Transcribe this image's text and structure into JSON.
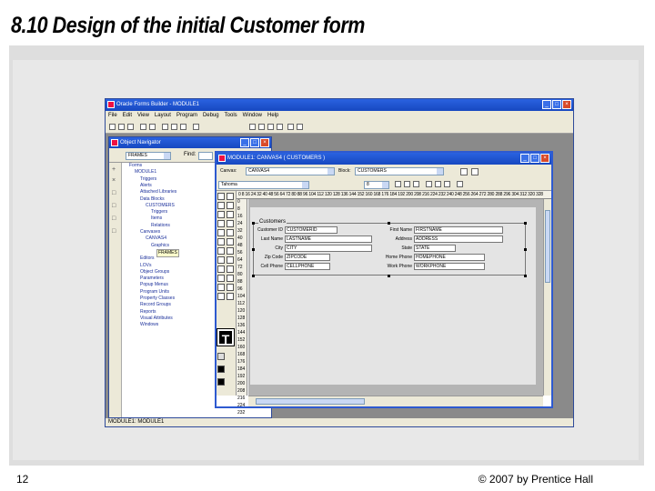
{
  "slide": {
    "title": "8.10 Design of the initial Customer form",
    "number": "12",
    "copyright": "© 2007 by Prentice Hall"
  },
  "app": {
    "title": "Oracle Forms Builder - MODULE1",
    "menu": [
      "File",
      "Edit",
      "View",
      "Layout",
      "Program",
      "Debug",
      "Tools",
      "Window",
      "Help"
    ],
    "status_text": "MODULE1: MODULE1"
  },
  "navigator": {
    "title": "Object Navigator",
    "search_value": "FRAMES",
    "find_label": "Find:",
    "tree": [
      {
        "label": "Forms",
        "level": 0
      },
      {
        "label": "MODULE1",
        "level": 1
      },
      {
        "label": "Triggers",
        "level": 2
      },
      {
        "label": "Alerts",
        "level": 2
      },
      {
        "label": "Attached Libraries",
        "level": 2
      },
      {
        "label": "Data Blocks",
        "level": 2
      },
      {
        "label": "CUSTOMERS",
        "level": 3
      },
      {
        "label": "Triggers",
        "level": 4
      },
      {
        "label": "Items",
        "level": 4
      },
      {
        "label": "Relations",
        "level": 4
      },
      {
        "label": "Canvases",
        "level": 2
      },
      {
        "label": "CANVAS4",
        "level": 3
      },
      {
        "label": "Graphics",
        "level": 4
      },
      {
        "label": "FRAMES",
        "level": 5,
        "selected": true
      },
      {
        "label": "Editors",
        "level": 2
      },
      {
        "label": "LOVs",
        "level": 2
      },
      {
        "label": "Object Groups",
        "level": 2
      },
      {
        "label": "Parameters",
        "level": 2
      },
      {
        "label": "Popup Menus",
        "level": 2
      },
      {
        "label": "Program Units",
        "level": 2
      },
      {
        "label": "Property Classes",
        "level": 2
      },
      {
        "label": "Record Groups",
        "level": 2
      },
      {
        "label": "Reports",
        "level": 2
      },
      {
        "label": "Visual Attributes",
        "level": 2
      },
      {
        "label": "Windows",
        "level": 2
      }
    ]
  },
  "canvas_window": {
    "title": "MODULE1: CANVAS4 ( CUSTOMERS )",
    "canvas_label": "Canvas:",
    "canvas_value": "CANVAS4",
    "block_label": "Block:",
    "block_value": "CUSTOMERS",
    "font_value": "Tahoma",
    "size_value": "8",
    "ruler_top": "0 8 16 24 32 40 48 56 64 72 80 88 96 104 112 120 128 136 144 152 160 168 176 184 192 200 208 216 224 232 240 248 256 264 272 280 288 296 304 312 320 328",
    "ruler_left": [
      "0",
      "8",
      "16",
      "24",
      "32",
      "40",
      "48",
      "56",
      "64",
      "72",
      "80",
      "88",
      "96",
      "104",
      "112",
      "120",
      "128",
      "136",
      "144",
      "152",
      "160",
      "168",
      "176",
      "184",
      "192",
      "200",
      "208",
      "216",
      "224",
      "232"
    ],
    "frame_title": "Customers",
    "left_fields": [
      {
        "label": "Customer ID",
        "value": "CUSTOMERID"
      },
      {
        "label": "Last Name",
        "value": "LASTNAME"
      },
      {
        "label": "City",
        "value": "CITY"
      },
      {
        "label": "Zip Code",
        "value": "ZIPCODE"
      },
      {
        "label": "Cell Phone",
        "value": "CELLPHONE"
      }
    ],
    "right_fields": [
      {
        "label": "First Name",
        "value": "FIRSTNAME"
      },
      {
        "label": "Address",
        "value": "ADDRESS"
      },
      {
        "label": "State",
        "value": "STATE"
      },
      {
        "label": "Home Phone",
        "value": "HOMEPHONE"
      },
      {
        "label": "Work Phone",
        "value": "WORKPHONE"
      }
    ]
  },
  "colors": {
    "titlebar": "#1748c0",
    "panel": "#ece9d8",
    "canvas": "#e4e4e4"
  }
}
